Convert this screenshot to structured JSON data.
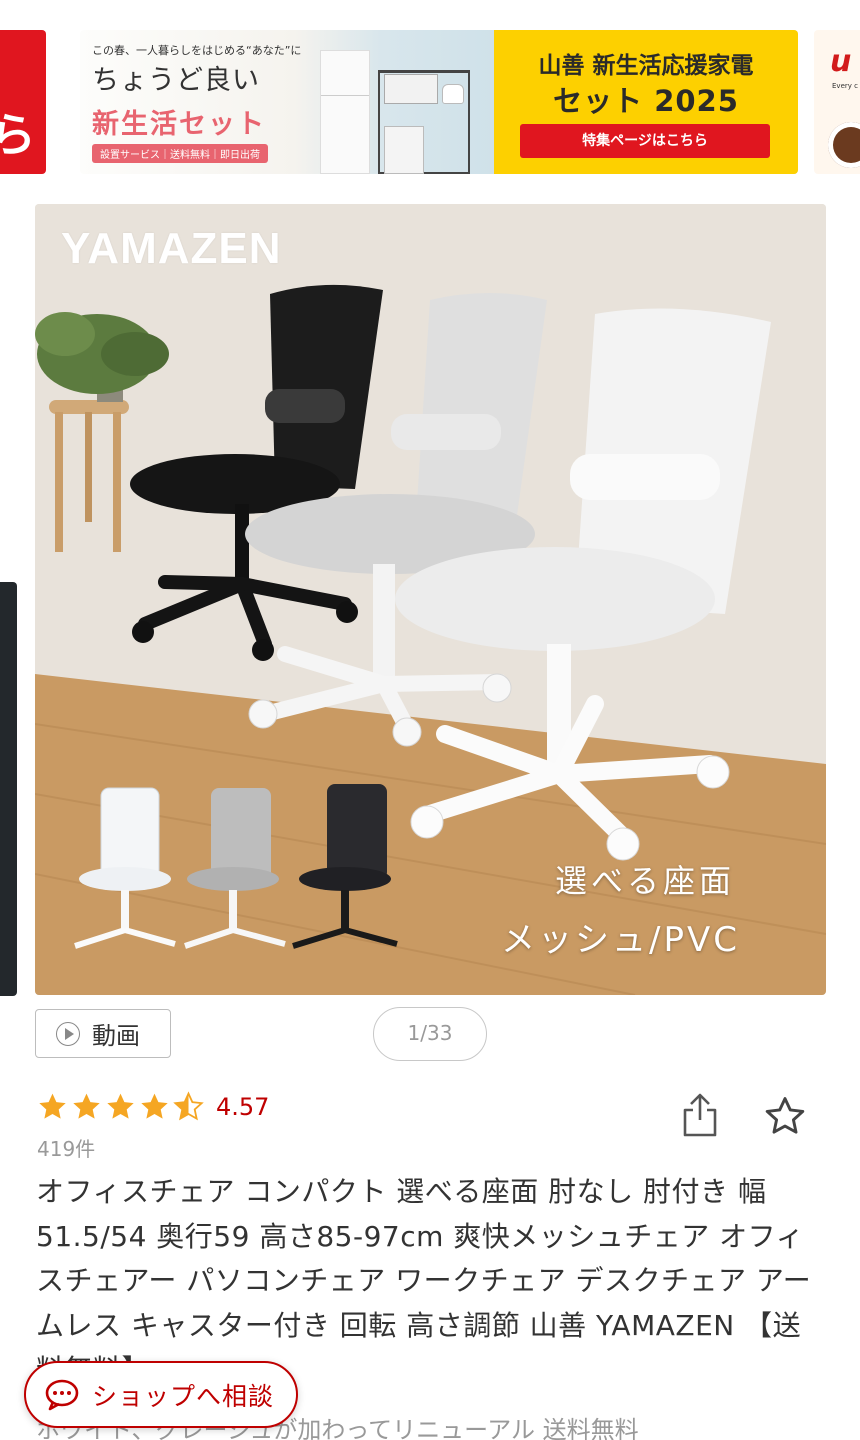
{
  "banner": {
    "catch": "この春、一人暮らしをはじめる“あなた”に",
    "title1": "ちょうど良い",
    "title2": "新生活セット",
    "services": "設置サービス｜送料無料｜即日出荷",
    "promo_line1": "山善 新生活応援家電",
    "promo_line2": "セット 2025",
    "promo_button": "特集ページはこちら",
    "left_peek_text": "ら",
    "right_peek_logo": "u",
    "right_peek_tag": "Every c"
  },
  "gallery": {
    "brand": "YAMAZEN",
    "caption1": "選べる座面",
    "caption2": "メッシュ/PVC",
    "video_label": "動画",
    "counter": "1/33",
    "colors": {
      "black": "#141414",
      "gray": "#c9c9c9",
      "white": "#f2f2f2",
      "floor": "#c99a63",
      "wall": "#e7e1d8"
    }
  },
  "rating": {
    "value": "4.57",
    "stars": 4.5,
    "count": "419件",
    "star_color": "#f5a623"
  },
  "product": {
    "title": "オフィスチェア コンパクト 選べる座面 肘なし 肘付き 幅51.5/54 奥行59 高さ85-97cm 爽快メッシュチェア オフィスチェアー パソコンチェア ワークチェア デスクチェア アームレス キャスター付き 回転 高さ調節 山善 YAMAZEN 【送料無料】",
    "subtitle": "ホワイト、グレージュが加わってリニューアル 送料無料"
  },
  "shop_chat": {
    "label": "ショップへ相談",
    "accent": "#bf0000"
  }
}
